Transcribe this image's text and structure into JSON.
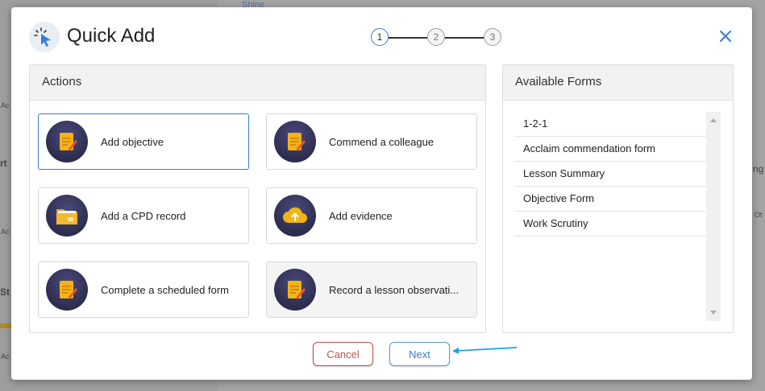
{
  "background": {
    "fragments": [
      "Shine",
      "Ac",
      "rt",
      "Ac",
      "St",
      "Ac",
      "ng",
      "Ot"
    ]
  },
  "modal": {
    "title": "Quick Add",
    "steps": [
      "1",
      "2",
      "3"
    ],
    "active_step": 1,
    "close_icon": "close-icon"
  },
  "actions": {
    "heading": "Actions",
    "items": [
      {
        "label": "Add objective",
        "icon": "document-pencil-icon",
        "selected": true
      },
      {
        "label": "Commend a colleague",
        "icon": "document-pencil-icon"
      },
      {
        "label": "Add a CPD record",
        "icon": "folder-icon"
      },
      {
        "label": "Add evidence",
        "icon": "cloud-upload-icon"
      },
      {
        "label": "Complete a scheduled form",
        "icon": "document-pencil-icon"
      },
      {
        "label": "Record a lesson observati...",
        "icon": "document-pencil-icon"
      }
    ]
  },
  "forms": {
    "heading": "Available Forms",
    "items": [
      "1-2-1",
      "Acclaim commendation form",
      "Lesson Summary",
      "Objective Form",
      "Work Scrutiny"
    ]
  },
  "buttons": {
    "cancel": "Cancel",
    "next": "Next"
  },
  "colors": {
    "accent": "#3a7bd5",
    "cancel": "#c0504d",
    "arrow": "#1aa3e0"
  }
}
